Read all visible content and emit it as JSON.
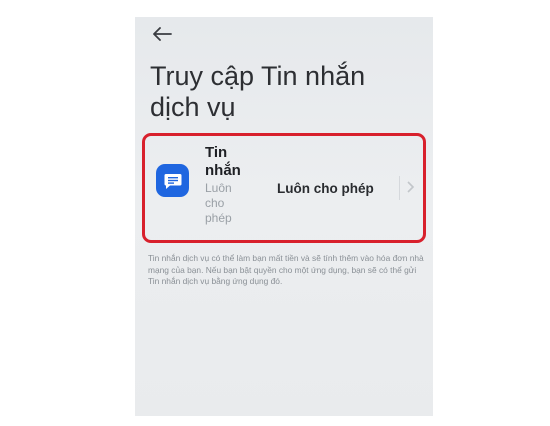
{
  "header": {
    "back_icon": "arrow-left-icon",
    "title": "Truy cập Tin nhắn dịch vụ"
  },
  "app_row": {
    "icon": "message-icon",
    "icon_color": "#1f66e0",
    "name": "Tin nhắn",
    "subtitle": "Luôn cho phép",
    "permission": "Luôn cho phép",
    "chevron_icon": "chevron-right-icon",
    "highlight_color": "#d8202c"
  },
  "description": "Tin nhắn dịch vụ có thể làm bạn mất tiền và sẽ tính thêm vào hóa đơn nhà mạng của bạn. Nếu bạn bật quyền cho một ứng dụng, bạn sẽ có thể gửi Tin nhắn dịch vụ bằng ứng dụng đó."
}
